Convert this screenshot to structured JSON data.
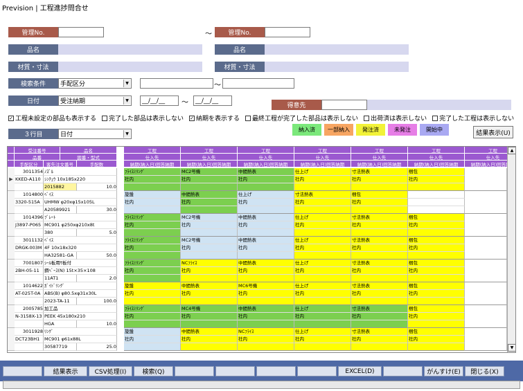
{
  "window_title": "Prevision | 工程進捗問合せ",
  "form": {
    "kanri_label1": "管理No.",
    "kanri_value1": "",
    "tilde1": "～",
    "kanri_label2": "管理No.",
    "kanri_value2": "",
    "hinmei_label1": "品名",
    "hinmei_label2": "品名",
    "zaishitsu_label1": "材質・寸法",
    "zaishitsu_label2": "材質・寸法",
    "kensaku_label": "検索条件",
    "kensaku_select": "手配区分",
    "kensaku_from": "",
    "tilde2": "～",
    "kensaku_to": "",
    "hizuke_label": "日付",
    "hizuke_select": "受注納期",
    "date_from": "__/__/__",
    "tilde3": "～",
    "date_to": "__/__/__",
    "tokuisaki_label": "得意先",
    "tokuisaki_value": "",
    "gyou3_label": "３行目",
    "gyou3_select": "日付"
  },
  "checks": [
    {
      "label": "工程未設定の部品も表示する",
      "checked": true
    },
    {
      "label": "完了した部品は表示しない",
      "checked": false
    },
    {
      "label": "納期を表示する",
      "checked": true
    },
    {
      "label": "最終工程が完了した部品は表示しない",
      "checked": false
    },
    {
      "label": "出荷済は表示しない",
      "checked": false
    },
    {
      "label": "完了した工程は表示しない",
      "checked": false
    }
  ],
  "legend": [
    {
      "label": "納入済",
      "color": "#7be87b"
    },
    {
      "label": "一部納入",
      "color": "#f7a562"
    },
    {
      "label": "発注済",
      "color": "#f2f238"
    },
    {
      "label": "未発注",
      "color": "#e67ee6"
    },
    {
      "label": "開始中",
      "color": "#a9a9f2"
    }
  ],
  "result_btn": "結果表示(U)",
  "grid": {
    "left_headers": [
      [
        "受注番号",
        "品名"
      ],
      [
        "品番",
        "図番・型式"
      ],
      [
        "手配区分",
        "客先注文番号",
        "手配数"
      ]
    ],
    "proc_headers": [
      "工程",
      "仕入先",
      "納期(納入日)回答納期"
    ],
    "rows": [
      {
        "no": "3011354",
        "name": "ﾉｽﾞﾙ",
        "code": "KKED-A110",
        "spec": "ｼﾝﾁｭｳ 10x185x220",
        "order": "2015882",
        "qty": "10.0",
        "procs": [
          [
            "ﾌﾗｲｽﾐﾘﾝｸﾞ",
            "社内",
            "g"
          ],
          [
            "MC2号機",
            "社内",
            "g"
          ],
          [
            "中間熱表",
            "社内",
            "g"
          ],
          [
            "仕上げ",
            "社内",
            "y"
          ],
          [
            "寸法熱表",
            "社内",
            "y"
          ],
          [
            "梱包",
            "社内",
            "y"
          ]
        ]
      },
      {
        "no": "1014800",
        "name": "ﾍﾞｲｽ",
        "code": "3320-515A",
        "spec": "UHMW φ20xφ15x105L",
        "order": "A20589921",
        "qty": "30.0",
        "procs": [
          [
            "旋盤",
            "社内",
            "b"
          ],
          [
            "中間熱表",
            "社内",
            "g"
          ],
          [
            "仕上げ",
            "社内",
            "b"
          ],
          [
            "寸法熱表",
            "社内",
            "y"
          ],
          [
            "梱包",
            "社内",
            "y"
          ],
          [
            "",
            "",
            "w"
          ]
        ]
      },
      {
        "no": "1014396",
        "name": "ﾌﾞﾚｰﾄ",
        "code": "J3897-P065",
        "spec": "MC901 φ250xφ210x8t",
        "order": "380",
        "qty": "5.0",
        "procs": [
          [
            "ﾌﾗｲｽﾐﾘﾝｸﾞ",
            "社内",
            "g"
          ],
          [
            "MC2号機",
            "社内",
            "b"
          ],
          [
            "中間熱表",
            "社内",
            "b"
          ],
          [
            "仕上げ",
            "社内",
            "y"
          ],
          [
            "寸法熱表",
            "社内",
            "y"
          ],
          [
            "梱包",
            "社内",
            "y"
          ]
        ]
      },
      {
        "no": "3011132",
        "name": "ﾍﾞｲｽ",
        "code": "DRGK-003M",
        "spec": "4F 10x18x320",
        "order": "HA32581-GA",
        "qty": "50.0",
        "procs": [
          [
            "ﾌﾗｲｽﾐﾘﾝｸﾞ",
            "社内",
            "g"
          ],
          [
            "MC2号機",
            "社内",
            "b"
          ],
          [
            "中間熱表",
            "社内",
            "b"
          ],
          [
            "仕上げ",
            "社内",
            "y"
          ],
          [
            "寸法熱表",
            "社内",
            "y"
          ],
          [
            "梱包",
            "社内",
            "y"
          ]
        ]
      },
      {
        "no": "7001807",
        "name": "ｼｰﾙ板用ｻ板付",
        "code": "2BH-05-11",
        "spec": "鋼ﾍﾞｰｽ(N) 15t×35×108",
        "order": "11AT1",
        "qty": "2.0",
        "procs": [
          [
            "ﾌﾗｲｽﾐﾘﾝｸﾞ",
            "社内",
            "g"
          ],
          [
            "NCﾌﾗｲｽ",
            "社内",
            "y"
          ],
          [
            "中間熱表",
            "社内",
            "y"
          ],
          [
            "仕上げ",
            "社内",
            "y"
          ],
          [
            "寸法熱表",
            "社内",
            "y"
          ],
          [
            "梱包",
            "社内",
            "y"
          ]
        ]
      },
      {
        "no": "1014622",
        "name": "ｶﾞｲﾄﾞﾘﾝｸﾞ",
        "code": "AT-025T-0A",
        "spec": "ABS(B) φ80.5xφ31x30L",
        "order": "2023-TA-11",
        "qty": "100.0",
        "procs": [
          [
            "旋盤",
            "社内",
            "y"
          ],
          [
            "中間熱表",
            "社内",
            "y"
          ],
          [
            "MC6号機",
            "社内",
            "y"
          ],
          [
            "仕上げ",
            "社内",
            "y"
          ],
          [
            "寸法熱表",
            "社内",
            "y"
          ],
          [
            "梱包",
            "社内",
            "y"
          ]
        ]
      },
      {
        "no": "2005785",
        "name": "加工品",
        "code": "N-3158X-13",
        "spec": "PEEK 45x180x210",
        "order": "HGA",
        "qty": "10.0",
        "procs": [
          [
            "ﾌﾗｲｽﾐﾘﾝｸﾞ",
            "社内",
            "g"
          ],
          [
            "MC4号機",
            "社内",
            "g"
          ],
          [
            "中間熱表",
            "社内",
            "g"
          ],
          [
            "仕上げ",
            "社内",
            "g"
          ],
          [
            "寸法熱表",
            "社内",
            "g"
          ],
          [
            "梱包",
            "社内",
            "y"
          ]
        ]
      },
      {
        "no": "3011928",
        "name": "ﾘﾝｸﾞ",
        "code": "DCT23BH1",
        "spec": "MC901 φ61x88L",
        "order": "30587719",
        "qty": "25.0",
        "procs": [
          [
            "旋盤",
            "社内",
            "b"
          ],
          [
            "中間熱表",
            "社内",
            "y"
          ],
          [
            "NCﾌﾗｲｽ",
            "社内",
            "y"
          ],
          [
            "仕上げ",
            "社内",
            "y"
          ],
          [
            "寸法熱表",
            "社内",
            "y"
          ],
          [
            "梱包",
            "社内",
            "y"
          ]
        ]
      }
    ]
  },
  "footer": [
    "",
    "結果表示",
    "CSV処理(I)",
    "検索(Q)",
    "",
    "",
    "",
    "",
    "EXCEL(D)",
    "",
    "がんすけ(E)",
    "閉じる(X)"
  ],
  "colors": {
    "g": "#7ccf4f",
    "y": "#ffff00",
    "b": "#cfe3f3",
    "w": "#ffffff"
  }
}
